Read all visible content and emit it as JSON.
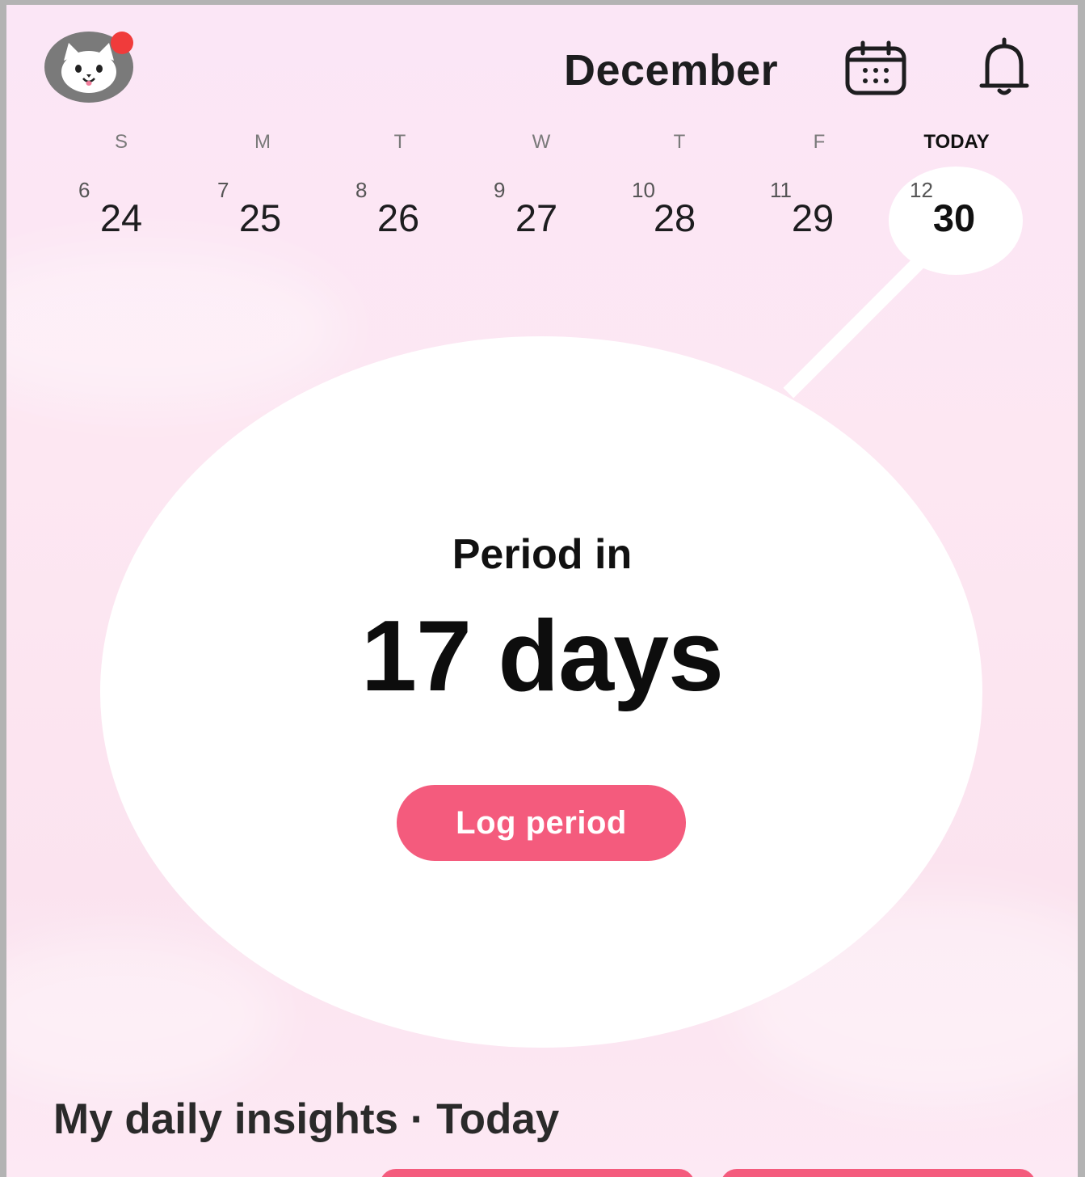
{
  "header": {
    "month": "December",
    "icons": {
      "avatar": "cat-avatar-icon",
      "calendar": "calendar-icon",
      "notifications": "bell-icon"
    },
    "notification_dot_color": "#f03b3b"
  },
  "week": {
    "weekday_labels": [
      "S",
      "M",
      "T",
      "W",
      "T",
      "F",
      "TODAY"
    ],
    "days": [
      {
        "cycle_day": "6",
        "date": "24"
      },
      {
        "cycle_day": "7",
        "date": "25"
      },
      {
        "cycle_day": "8",
        "date": "26"
      },
      {
        "cycle_day": "9",
        "date": "27"
      },
      {
        "cycle_day": "10",
        "date": "28"
      },
      {
        "cycle_day": "11",
        "date": "29"
      },
      {
        "cycle_day": "12",
        "date": "30"
      }
    ],
    "selected_date": "30"
  },
  "prediction": {
    "label": "Period in",
    "value": "17 days",
    "button_label": "Log period"
  },
  "insights": {
    "title": "My daily insights · Today"
  },
  "colors": {
    "accent": "#f45b7d",
    "background": "#fbe6f6",
    "circle": "#ffffff",
    "text": "#111111"
  }
}
